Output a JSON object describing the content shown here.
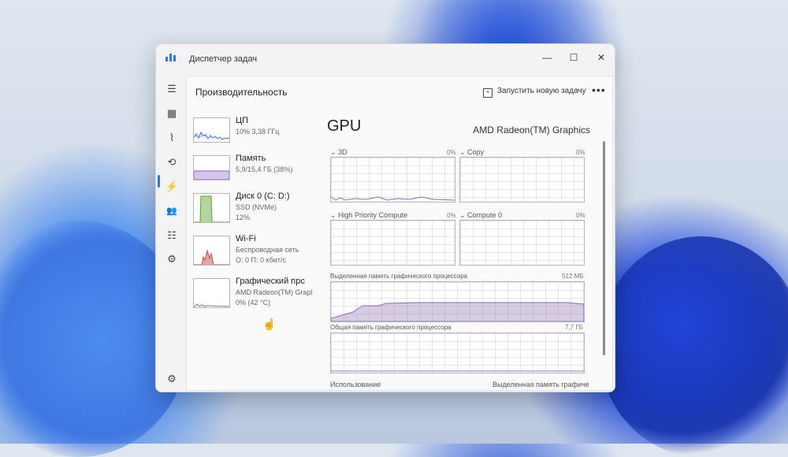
{
  "window": {
    "title": "Диспетчер задач",
    "controls": {
      "minimize": "—",
      "maximize": "☐",
      "close": "✕"
    }
  },
  "sidebar": {
    "icons": [
      "hamburger-icon",
      "processes-icon",
      "performance-icon",
      "history-icon",
      "startup-icon",
      "users-icon",
      "details-icon",
      "services-icon",
      "settings-icon"
    ],
    "icon_glyphs": [
      "☰",
      "▦",
      "⌇",
      "⟲",
      "⚡",
      "👥",
      "☷",
      "⚙",
      "⚙"
    ],
    "active": "performance-icon"
  },
  "header": {
    "title": "Производительность",
    "run_task_label": "Запустить новую задачу",
    "more_label": "•••"
  },
  "resources": [
    {
      "name": "ЦП",
      "sub1": "10%  3,38 ГГц",
      "sub2": "",
      "sub3": ""
    },
    {
      "name": "Память",
      "sub1": "5,9/15,4 ГБ (38%)",
      "sub2": "",
      "sub3": ""
    },
    {
      "name": "Диск 0 (C: D:)",
      "sub1": "SSD (NVMe)",
      "sub2": "12%",
      "sub3": ""
    },
    {
      "name": "Wi-Fi",
      "sub1": "Беспроводная сеть",
      "sub2": "О: 0  П: 0 кбит/с",
      "sub3": ""
    },
    {
      "name": "Графический прс",
      "sub1": "AMD Radeon(TM) Grapl",
      "sub2": "0% (42 °C)",
      "sub3": ""
    }
  ],
  "gpu": {
    "title": "GPU",
    "name": "AMD Radeon(TM) Graphics",
    "engines": [
      {
        "label": "3D",
        "pct": "0%"
      },
      {
        "label": "Copy",
        "pct": "0%"
      },
      {
        "label": "High Priority Compute",
        "pct": "0%"
      },
      {
        "label": "Compute 0",
        "pct": "0%"
      }
    ],
    "dedicated_label": "Выделенная память графического процессора",
    "dedicated_value": "512 МБ",
    "shared_label": "Общая память графического процессора",
    "shared_value": "7,7 ГБ",
    "usage_label": "Использование",
    "dedicated_footer": "Выделенная память графиче"
  },
  "colors": {
    "cpu": "#3a78d6",
    "memory": "#8a5cc8",
    "disk": "#5aa02c",
    "wifi": "#c0504d",
    "gpu": "#8a6fb0"
  }
}
